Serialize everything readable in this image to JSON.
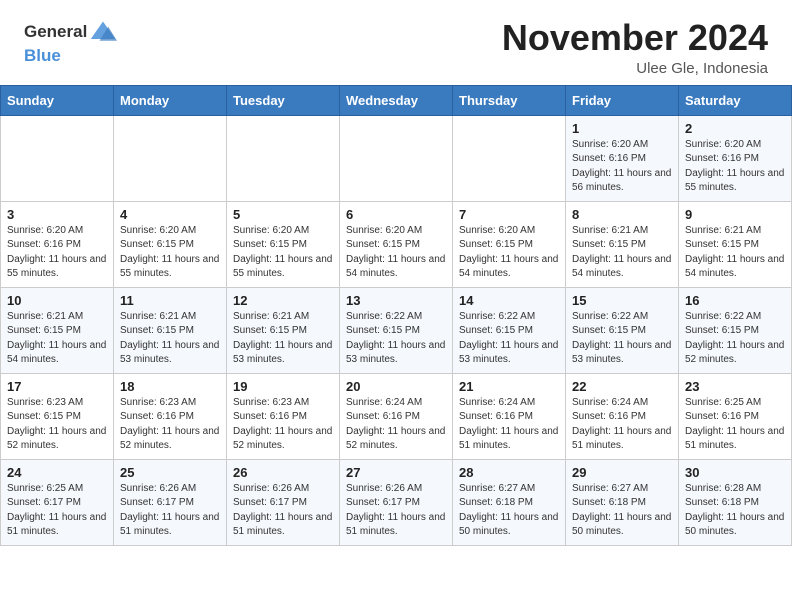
{
  "header": {
    "logo_general": "General",
    "logo_blue": "Blue",
    "month_title": "November 2024",
    "subtitle": "Ulee Gle, Indonesia"
  },
  "days_header": [
    "Sunday",
    "Monday",
    "Tuesday",
    "Wednesday",
    "Thursday",
    "Friday",
    "Saturday"
  ],
  "weeks": [
    [
      {
        "num": "",
        "detail": ""
      },
      {
        "num": "",
        "detail": ""
      },
      {
        "num": "",
        "detail": ""
      },
      {
        "num": "",
        "detail": ""
      },
      {
        "num": "",
        "detail": ""
      },
      {
        "num": "1",
        "detail": "Sunrise: 6:20 AM\nSunset: 6:16 PM\nDaylight: 11 hours\nand 56 minutes."
      },
      {
        "num": "2",
        "detail": "Sunrise: 6:20 AM\nSunset: 6:16 PM\nDaylight: 11 hours\nand 55 minutes."
      }
    ],
    [
      {
        "num": "3",
        "detail": "Sunrise: 6:20 AM\nSunset: 6:16 PM\nDaylight: 11 hours\nand 55 minutes."
      },
      {
        "num": "4",
        "detail": "Sunrise: 6:20 AM\nSunset: 6:15 PM\nDaylight: 11 hours\nand 55 minutes."
      },
      {
        "num": "5",
        "detail": "Sunrise: 6:20 AM\nSunset: 6:15 PM\nDaylight: 11 hours\nand 55 minutes."
      },
      {
        "num": "6",
        "detail": "Sunrise: 6:20 AM\nSunset: 6:15 PM\nDaylight: 11 hours\nand 54 minutes."
      },
      {
        "num": "7",
        "detail": "Sunrise: 6:20 AM\nSunset: 6:15 PM\nDaylight: 11 hours\nand 54 minutes."
      },
      {
        "num": "8",
        "detail": "Sunrise: 6:21 AM\nSunset: 6:15 PM\nDaylight: 11 hours\nand 54 minutes."
      },
      {
        "num": "9",
        "detail": "Sunrise: 6:21 AM\nSunset: 6:15 PM\nDaylight: 11 hours\nand 54 minutes."
      }
    ],
    [
      {
        "num": "10",
        "detail": "Sunrise: 6:21 AM\nSunset: 6:15 PM\nDaylight: 11 hours\nand 54 minutes."
      },
      {
        "num": "11",
        "detail": "Sunrise: 6:21 AM\nSunset: 6:15 PM\nDaylight: 11 hours\nand 53 minutes."
      },
      {
        "num": "12",
        "detail": "Sunrise: 6:21 AM\nSunset: 6:15 PM\nDaylight: 11 hours\nand 53 minutes."
      },
      {
        "num": "13",
        "detail": "Sunrise: 6:22 AM\nSunset: 6:15 PM\nDaylight: 11 hours\nand 53 minutes."
      },
      {
        "num": "14",
        "detail": "Sunrise: 6:22 AM\nSunset: 6:15 PM\nDaylight: 11 hours\nand 53 minutes."
      },
      {
        "num": "15",
        "detail": "Sunrise: 6:22 AM\nSunset: 6:15 PM\nDaylight: 11 hours\nand 53 minutes."
      },
      {
        "num": "16",
        "detail": "Sunrise: 6:22 AM\nSunset: 6:15 PM\nDaylight: 11 hours\nand 52 minutes."
      }
    ],
    [
      {
        "num": "17",
        "detail": "Sunrise: 6:23 AM\nSunset: 6:15 PM\nDaylight: 11 hours\nand 52 minutes."
      },
      {
        "num": "18",
        "detail": "Sunrise: 6:23 AM\nSunset: 6:16 PM\nDaylight: 11 hours\nand 52 minutes."
      },
      {
        "num": "19",
        "detail": "Sunrise: 6:23 AM\nSunset: 6:16 PM\nDaylight: 11 hours\nand 52 minutes."
      },
      {
        "num": "20",
        "detail": "Sunrise: 6:24 AM\nSunset: 6:16 PM\nDaylight: 11 hours\nand 52 minutes."
      },
      {
        "num": "21",
        "detail": "Sunrise: 6:24 AM\nSunset: 6:16 PM\nDaylight: 11 hours\nand 51 minutes."
      },
      {
        "num": "22",
        "detail": "Sunrise: 6:24 AM\nSunset: 6:16 PM\nDaylight: 11 hours\nand 51 minutes."
      },
      {
        "num": "23",
        "detail": "Sunrise: 6:25 AM\nSunset: 6:16 PM\nDaylight: 11 hours\nand 51 minutes."
      }
    ],
    [
      {
        "num": "24",
        "detail": "Sunrise: 6:25 AM\nSunset: 6:17 PM\nDaylight: 11 hours\nand 51 minutes."
      },
      {
        "num": "25",
        "detail": "Sunrise: 6:26 AM\nSunset: 6:17 PM\nDaylight: 11 hours\nand 51 minutes."
      },
      {
        "num": "26",
        "detail": "Sunrise: 6:26 AM\nSunset: 6:17 PM\nDaylight: 11 hours\nand 51 minutes."
      },
      {
        "num": "27",
        "detail": "Sunrise: 6:26 AM\nSunset: 6:17 PM\nDaylight: 11 hours\nand 51 minutes."
      },
      {
        "num": "28",
        "detail": "Sunrise: 6:27 AM\nSunset: 6:18 PM\nDaylight: 11 hours\nand 50 minutes."
      },
      {
        "num": "29",
        "detail": "Sunrise: 6:27 AM\nSunset: 6:18 PM\nDaylight: 11 hours\nand 50 minutes."
      },
      {
        "num": "30",
        "detail": "Sunrise: 6:28 AM\nSunset: 6:18 PM\nDaylight: 11 hours\nand 50 minutes."
      }
    ]
  ]
}
